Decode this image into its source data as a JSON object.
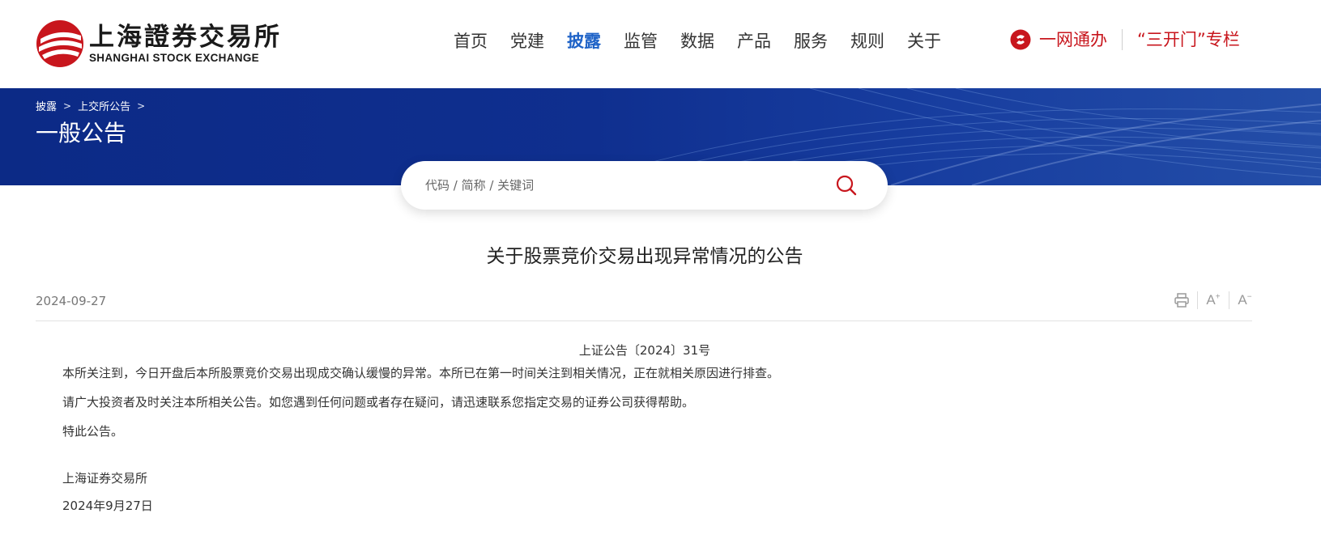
{
  "header": {
    "logo_cn": "上海證券交易所",
    "logo_en": "SHANGHAI STOCK EXCHANGE",
    "nav": [
      "首页",
      "党建",
      "披露",
      "监管",
      "数据",
      "产品",
      "服务",
      "规则",
      "关于"
    ],
    "active_nav": "披露",
    "ywtb": "一网通办",
    "skm": "“三开门”专栏"
  },
  "banner": {
    "breadcrumb": [
      "披露",
      "上交所公告"
    ],
    "title": "一般公告"
  },
  "search": {
    "placeholder": "代码 / 简称 / 关键词"
  },
  "article": {
    "title": "关于股票竞价交易出现异常情况的公告",
    "date": "2024-09-27",
    "tools": {
      "font_larger": "A",
      "font_smaller": "A"
    },
    "doc_no": "上证公告〔2024〕31号",
    "paragraphs": [
      "本所关注到，今日开盘后本所股票竞价交易出现成交确认缓慢的异常。本所已在第一时间关注到相关情况，正在就相关原因进行排查。",
      "请广大投资者及时关注本所相关公告。如您遇到任何问题或者存在疑问，请迅速联系您指定交易的证券公司获得帮助。",
      "特此公告。"
    ],
    "signature": "上海证券交易所",
    "sign_date": "2024年9月27日"
  },
  "colors": {
    "brand_red": "#c8161d",
    "nav_active": "#1f63c7",
    "banner_blue": "#0f2f8f"
  },
  "icons": [
    "sse-logo-icon",
    "ywtb-icon",
    "chevron-right-icon",
    "search-icon",
    "print-icon",
    "font-larger-icon",
    "font-smaller-icon"
  ]
}
